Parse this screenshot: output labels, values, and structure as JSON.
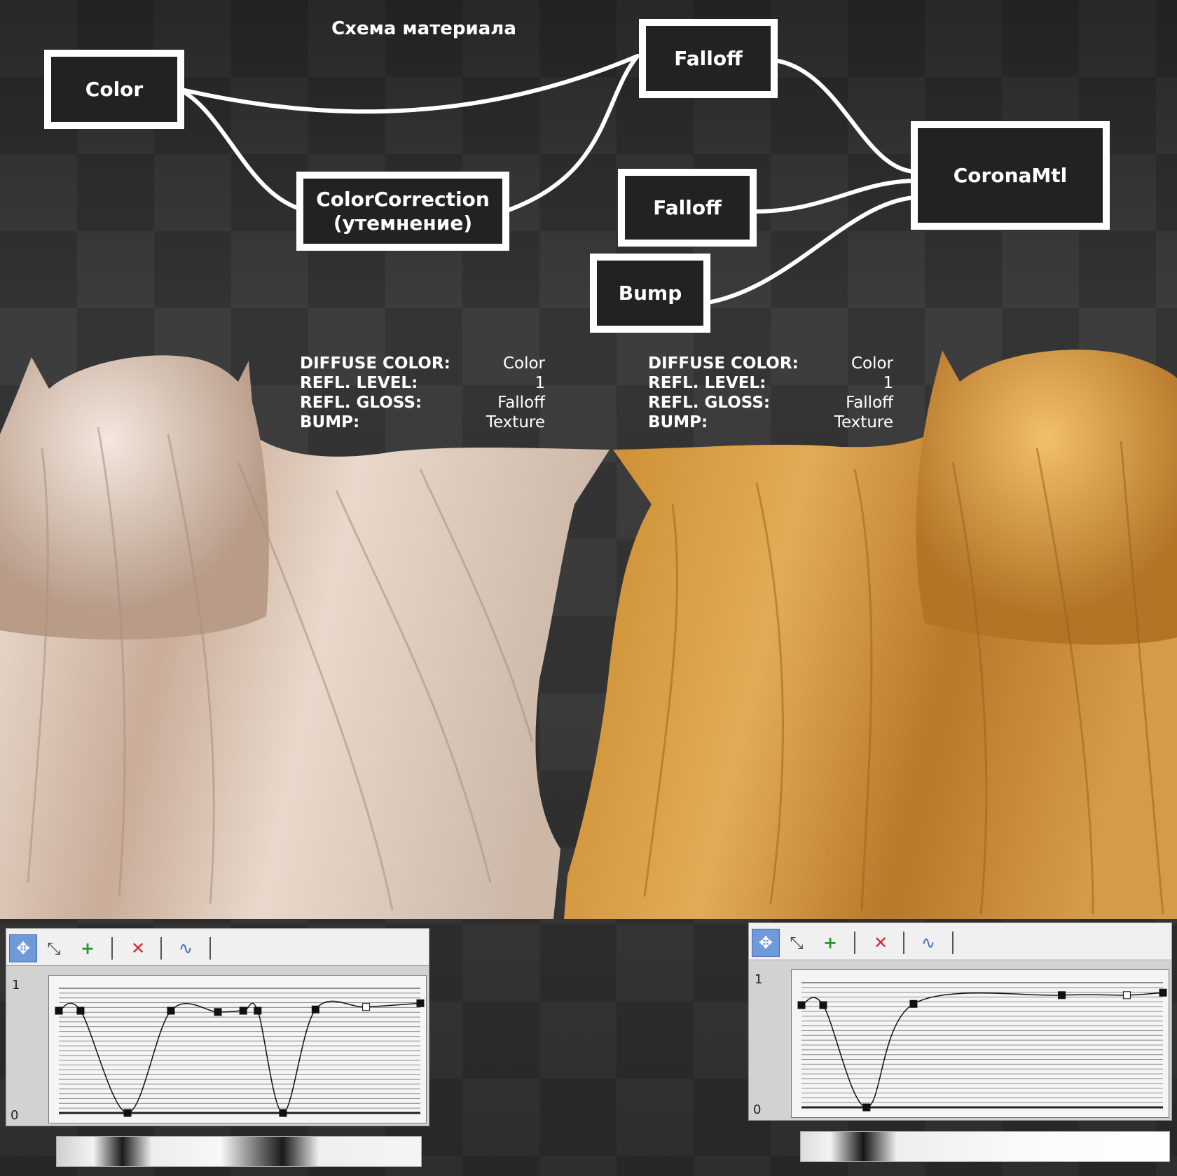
{
  "schema": {
    "title": "Схема материала",
    "nodes": {
      "color": "Color",
      "falloff_top": "Falloff",
      "color_correction_line1": "ColorCorrection",
      "color_correction_line2": "(утемнение)",
      "corona": "CoronaMtl",
      "falloff_mid": "Falloff",
      "bump": "Bump"
    }
  },
  "materials": [
    {
      "diffuse_label": "DIFFUSE COLOR:",
      "diffuse_value": "Color",
      "level_label": "REFL. LEVEL:",
      "level_value": "1",
      "gloss_label": "REFL. GLOSS:",
      "gloss_value": "Falloff",
      "bump_label": "BUMP:",
      "bump_value": "Texture",
      "cloth_color": "#e6d4c7"
    },
    {
      "diffuse_label": "DIFFUSE COLOR:",
      "diffuse_value": "Color",
      "level_label": "REFL. LEVEL:",
      "level_value": "1",
      "gloss_label": "REFL. GLOSS:",
      "gloss_value": "Falloff",
      "bump_label": "BUMP:",
      "bump_value": "Texture",
      "cloth_color": "#d9a04a"
    }
  ],
  "curve_editors": [
    {
      "y_max_label": "1",
      "y_min_label": "0",
      "points": [
        [
          0.0,
          0.82
        ],
        [
          0.06,
          0.82
        ],
        [
          0.19,
          0.0
        ],
        [
          0.31,
          0.82
        ],
        [
          0.44,
          0.81
        ],
        [
          0.51,
          0.82
        ],
        [
          0.55,
          0.82
        ],
        [
          0.62,
          0.0
        ],
        [
          0.71,
          0.83
        ],
        [
          0.85,
          0.85
        ],
        [
          1.0,
          0.88
        ]
      ]
    },
    {
      "y_max_label": "1",
      "y_min_label": "0",
      "points": [
        [
          0.0,
          0.82
        ],
        [
          0.06,
          0.82
        ],
        [
          0.18,
          0.0
        ],
        [
          0.31,
          0.83
        ],
        [
          0.72,
          0.9
        ],
        [
          0.9,
          0.9
        ],
        [
          1.0,
          0.92
        ]
      ]
    }
  ],
  "toolbar_icons": [
    "move-keys-icon",
    "scale-point-icon",
    "add-point-icon",
    "delete-point-icon",
    "reset-curve-icon"
  ],
  "colors": {
    "node_border": "#ffffff",
    "node_fill": "#222222",
    "delete_red": "#d9262c",
    "active_tool": "#6f99d9"
  }
}
